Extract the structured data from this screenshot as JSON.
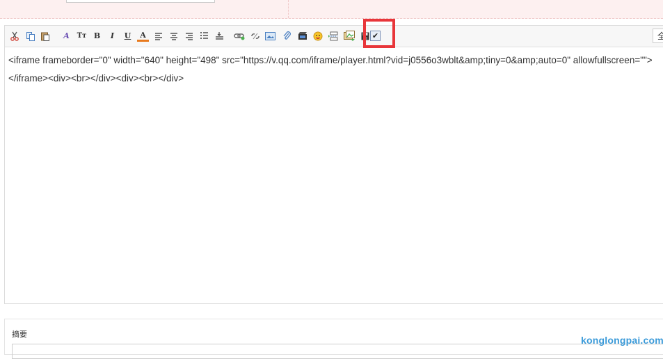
{
  "toolbar": {
    "items": [
      {
        "name": "cut-icon",
        "glyph": ""
      },
      {
        "name": "copy-icon",
        "glyph": ""
      },
      {
        "name": "paste-icon",
        "glyph": ""
      },
      {
        "name": "font-family-icon",
        "glyph": "A"
      },
      {
        "name": "font-size-icon",
        "glyph": "Tт"
      },
      {
        "name": "bold-icon",
        "glyph": "B"
      },
      {
        "name": "italic-icon",
        "glyph": "I"
      },
      {
        "name": "underline-icon",
        "glyph": "U"
      },
      {
        "name": "font-color-icon",
        "glyph": "A"
      },
      {
        "name": "align-left-icon",
        "glyph": ""
      },
      {
        "name": "align-center-icon",
        "glyph": ""
      },
      {
        "name": "align-right-icon",
        "glyph": ""
      },
      {
        "name": "ordered-list-icon",
        "glyph": ""
      },
      {
        "name": "unordered-list-icon",
        "glyph": ""
      },
      {
        "name": "link-icon",
        "glyph": ""
      },
      {
        "name": "unlink-icon",
        "glyph": ""
      },
      {
        "name": "image-icon",
        "glyph": ""
      },
      {
        "name": "attachment-icon",
        "glyph": ""
      },
      {
        "name": "video-icon",
        "glyph": ""
      },
      {
        "name": "emoji-icon",
        "glyph": ""
      },
      {
        "name": "page-break-icon",
        "glyph": ""
      },
      {
        "name": "insert-image-icon",
        "glyph": ""
      },
      {
        "name": "save-icon",
        "glyph": ""
      },
      {
        "name": "source-code-toggle-icon",
        "glyph": "✔"
      }
    ],
    "fullscreen_label": "全"
  },
  "editor": {
    "content": "<iframe frameborder=\"0\" width=\"640\" height=\"498\" src=\"https://v.qq.com/iframe/player.html?vid=j0556o3wblt&amp;tiny=0&amp;auto=0\" allowfullscreen=\"\"></iframe><div><br></div><div><br></div>"
  },
  "summary": {
    "label": "摘要"
  },
  "watermark": "konglongpai.com",
  "colors": {
    "highlight": "#e8363a",
    "watermark": "#3a9ad9"
  }
}
